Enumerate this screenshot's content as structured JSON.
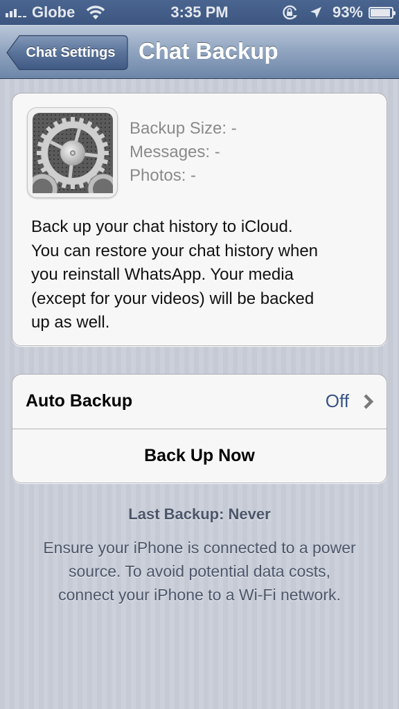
{
  "status_bar": {
    "carrier": "Globe",
    "time": "3:35 PM",
    "battery_percent": "93%",
    "battery_level": 0.93,
    "signal_bars": 3,
    "icons": [
      "signal-icon",
      "wifi-icon",
      "rotation-lock-icon",
      "location-icon",
      "battery-icon"
    ]
  },
  "nav": {
    "back_label": "Chat Settings",
    "title": "Chat Backup"
  },
  "info_card": {
    "icon": "settings-gear-icon",
    "stats": {
      "backup_size": "Backup Size: -",
      "messages": "Messages: -",
      "photos": "Photos: -"
    },
    "description": [
      "Back up your chat history to iCloud.",
      "You can restore your chat history when",
      "you reinstall WhatsApp. Your media",
      "(except for your videos) will be backed",
      "up as well."
    ]
  },
  "actions": {
    "auto_backup": {
      "label": "Auto Backup",
      "value": "Off"
    },
    "back_up_now": {
      "label": "Back Up Now"
    }
  },
  "footer": {
    "last_backup": "Last Backup: Never",
    "note": [
      "Ensure your iPhone is connected to a power",
      "source. To avoid potential data costs,",
      "connect your iPhone to a Wi-Fi network."
    ]
  },
  "colors": {
    "nav_bar": "#6d86a8",
    "status_bar": "#3c5680",
    "value_blue": "#385487",
    "background": "#c8ccd6",
    "footer_text": "#4c566a"
  }
}
